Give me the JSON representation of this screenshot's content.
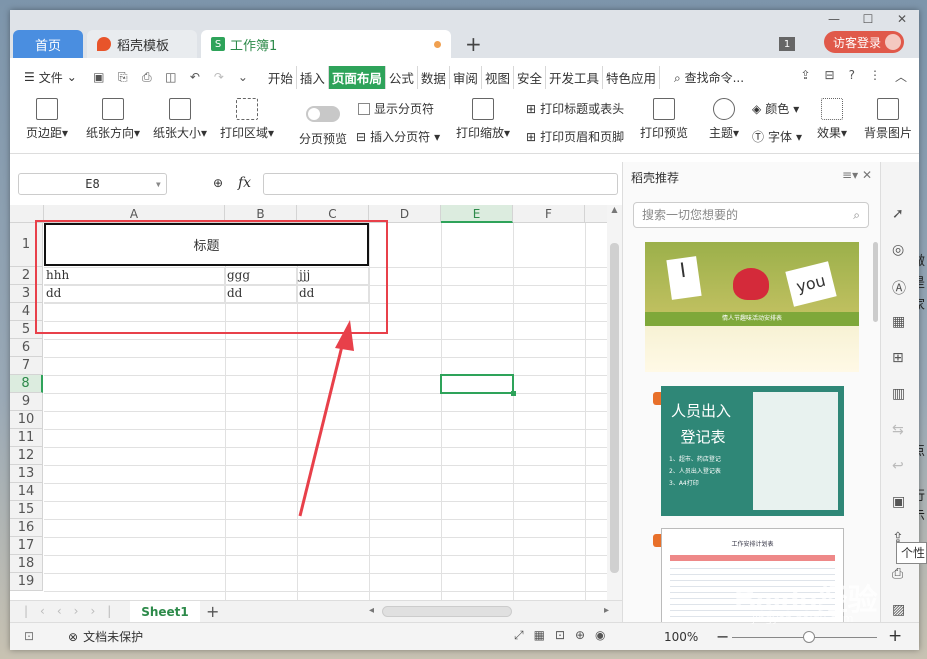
{
  "tabs": {
    "home": "首页",
    "template": "稻壳模板",
    "workbook": "工作簿1",
    "guest_login": "访客登录",
    "badge": "1"
  },
  "menu": {
    "file": "文件",
    "items": [
      "开始",
      "插入",
      "页面布局",
      "公式",
      "数据",
      "审阅",
      "视图",
      "安全",
      "开发工具",
      "特色应用"
    ],
    "active": "页面布局",
    "search": "查找命令..."
  },
  "ribbon": {
    "margins": "页边距",
    "orientation": "纸张方向",
    "size": "纸张大小",
    "print_area": "打印区域",
    "page_preview": "分页预览",
    "show_pagebreak": "显示分页符",
    "insert_pagebreak": "插入分页符",
    "print_scale": "打印缩放",
    "print_title": "打印标题或表头",
    "print_header": "打印页眉和页脚",
    "print_preview": "打印预览",
    "theme": "主题",
    "color": "颜色",
    "font": "字体",
    "effect": "效果",
    "background": "背景图片"
  },
  "formula_bar": {
    "name_box": "E8",
    "fx": "fx",
    "value": ""
  },
  "sheet": {
    "columns": [
      "A",
      "B",
      "C",
      "D",
      "E",
      "F"
    ],
    "rows": [
      "1",
      "2",
      "3",
      "4",
      "5",
      "6",
      "7",
      "8",
      "9",
      "10",
      "11",
      "12",
      "13",
      "14",
      "15",
      "16",
      "17",
      "18",
      "19"
    ],
    "selected_column": "E",
    "selected_row": "8",
    "title": "标题",
    "data": [
      [
        "hhh",
        "ggg",
        "jjj"
      ],
      [
        "dd",
        "dd",
        "dd"
      ]
    ],
    "tab": "Sheet1"
  },
  "status": {
    "protection": "文档未保护",
    "zoom": "100%"
  },
  "panel": {
    "title": "稻壳推荐",
    "search_placeholder": "搜索一切您想要的",
    "thumb1_caption": "情人节趣味活动安排表",
    "thumb2_title_1": "人员出入",
    "thumb2_title_2": "登记表",
    "thumb2_list": [
      "1、超市、药店登记",
      "2、人员出入登记表",
      "3、A4打印"
    ],
    "thumb3_caption": "工作安排计划表"
  },
  "tooltip": "个性",
  "desktop_text": [
    "做",
    "是",
    "家",
    "点",
    "行",
    "示"
  ],
  "watermark": "Baidu经验",
  "watermark_url": "jingyan.baidu.com"
}
